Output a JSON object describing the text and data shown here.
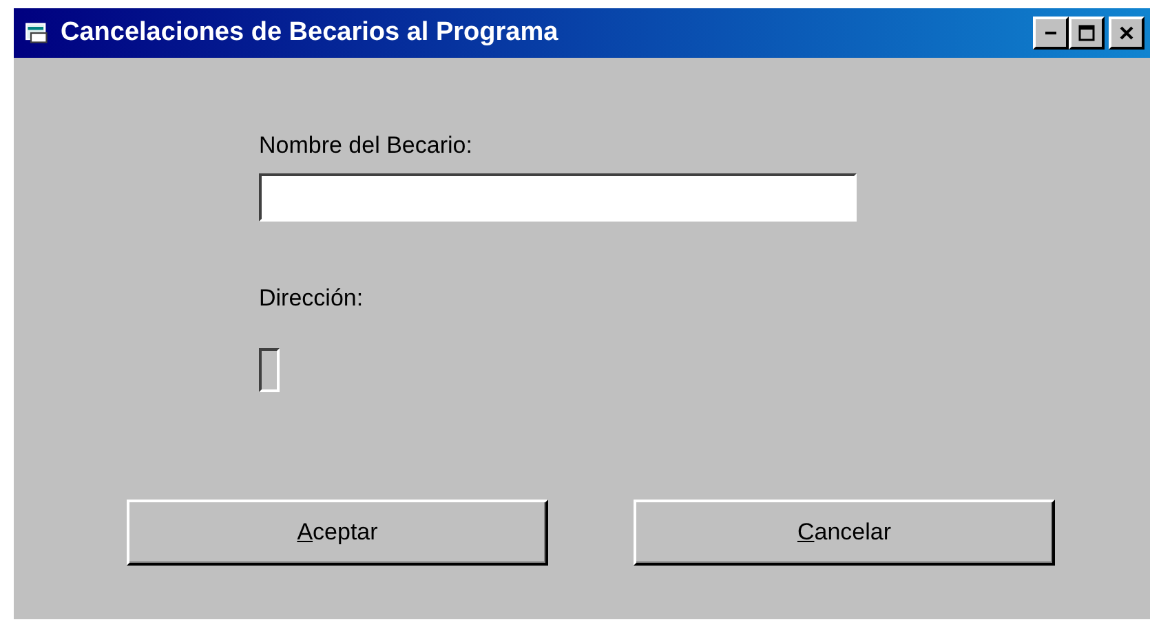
{
  "window": {
    "title": "Cancelaciones de Becarios al Programa"
  },
  "fields": [
    {
      "label": "Nombre del Becario:"
    },
    {
      "label": "Dirección:"
    }
  ],
  "buttons": [
    {
      "label": "Aceptar"
    },
    {
      "label": "Cancelar"
    }
  ]
}
